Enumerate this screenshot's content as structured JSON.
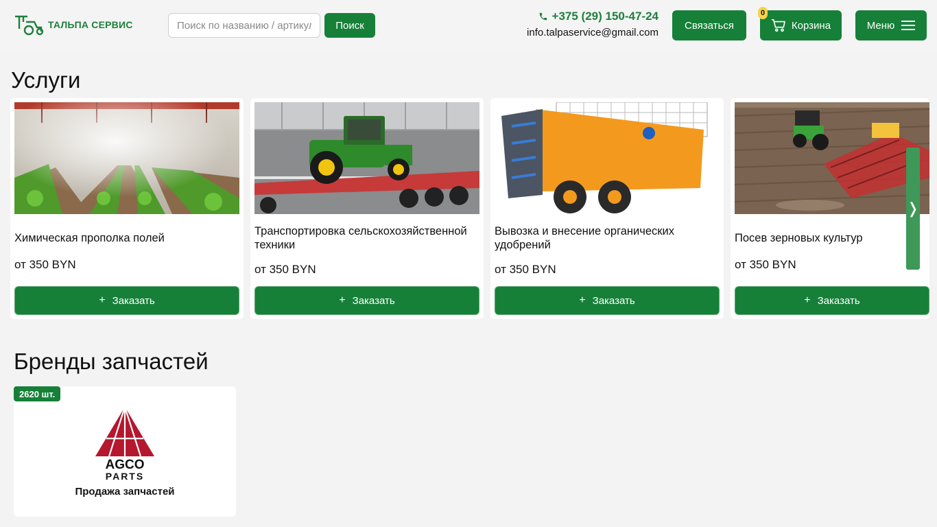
{
  "header": {
    "logo_text": "ТАЛЬПА СЕРВИС",
    "search_placeholder": "Поиск по названию / артикулу",
    "search_button": "Поиск",
    "phone": "+375 (29) 150-47-24",
    "email": "info.talpaservice@gmail.com",
    "contact_button": "Связаться",
    "cart_label": "Корзина",
    "cart_count": "0",
    "menu_label": "Меню"
  },
  "services": {
    "title": "Услуги",
    "items": [
      {
        "title": "Химическая прополка полей",
        "price": "от 350 BYN",
        "button": "Заказать"
      },
      {
        "title": "Транспортировка сельскохозяйственной техники",
        "price": "от 350 BYN",
        "button": "Заказать"
      },
      {
        "title": "Вывозка и внесение органических удобрений",
        "price": "от 350 BYN",
        "button": "Заказать"
      },
      {
        "title": "Посев зерновых культур",
        "price": "от 350 BYN",
        "button": "Заказать"
      }
    ],
    "next_arrow": "❭"
  },
  "brands": {
    "title": "Бренды запчастей",
    "items": [
      {
        "count": "2620 шт.",
        "logo_text_1": "AGCO",
        "logo_text_2": "PARTS",
        "caption": "Продажа запчастей"
      }
    ]
  },
  "colors": {
    "accent": "#168039",
    "logo_green": "#1e7f3b",
    "badge": "#f6d44c"
  }
}
